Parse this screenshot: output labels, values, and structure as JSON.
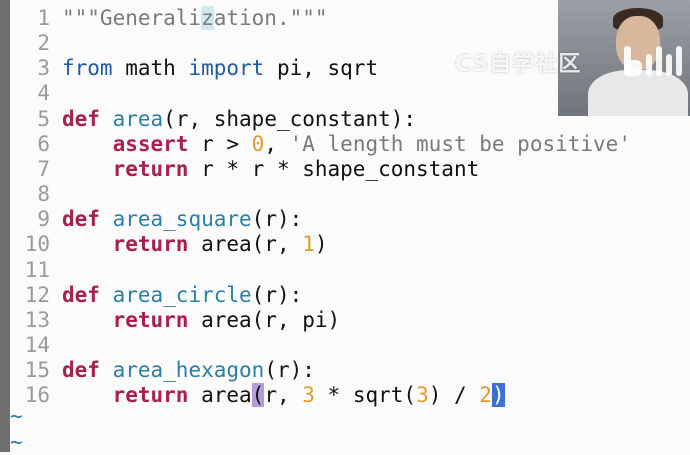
{
  "watermark_text": "CS自学社区",
  "logo_name": "bilibili",
  "colors": {
    "keyword": "#a8204c",
    "builtin_keyword": "#1f5aa8",
    "function_name": "#2a7fa6",
    "number": "#e39a2b",
    "string": "#7a7a7a",
    "cursor": "#3a6fd6",
    "paren_match": "#b39ddb"
  },
  "lines": [
    {
      "n": "1",
      "tokens": [
        {
          "t": "\"\"\"Generali",
          "c": "str"
        },
        {
          "t": "z",
          "c": "str mark"
        },
        {
          "t": "ation.\"\"\"",
          "c": "str"
        }
      ]
    },
    {
      "n": "2",
      "tokens": []
    },
    {
      "n": "3",
      "tokens": [
        {
          "t": "from",
          "c": "kw2"
        },
        {
          "t": " math ",
          "c": "id"
        },
        {
          "t": "import",
          "c": "kw2"
        },
        {
          "t": " pi, sqrt",
          "c": "id"
        }
      ]
    },
    {
      "n": "4",
      "tokens": []
    },
    {
      "n": "5",
      "tokens": [
        {
          "t": "def",
          "c": "kw"
        },
        {
          "t": " ",
          "c": "id"
        },
        {
          "t": "area",
          "c": "fn"
        },
        {
          "t": "(r, shape_constant):",
          "c": "id"
        }
      ]
    },
    {
      "n": "6",
      "tokens": [
        {
          "t": "    ",
          "c": "id"
        },
        {
          "t": "assert",
          "c": "kw"
        },
        {
          "t": " r > ",
          "c": "id"
        },
        {
          "t": "0",
          "c": "num"
        },
        {
          "t": ", ",
          "c": "id"
        },
        {
          "t": "'A length must be positive'",
          "c": "str"
        }
      ]
    },
    {
      "n": "7",
      "tokens": [
        {
          "t": "    ",
          "c": "id"
        },
        {
          "t": "return",
          "c": "kw"
        },
        {
          "t": " r * r * shape_constant",
          "c": "id"
        }
      ]
    },
    {
      "n": "8",
      "tokens": []
    },
    {
      "n": "9",
      "tokens": [
        {
          "t": "def",
          "c": "kw"
        },
        {
          "t": " ",
          "c": "id"
        },
        {
          "t": "area_square",
          "c": "fn"
        },
        {
          "t": "(r):",
          "c": "id"
        }
      ]
    },
    {
      "n": "10",
      "tokens": [
        {
          "t": "    ",
          "c": "id"
        },
        {
          "t": "return",
          "c": "kw"
        },
        {
          "t": " area(r, ",
          "c": "id"
        },
        {
          "t": "1",
          "c": "num"
        },
        {
          "t": ")",
          "c": "id"
        }
      ]
    },
    {
      "n": "11",
      "tokens": []
    },
    {
      "n": "12",
      "tokens": [
        {
          "t": "def",
          "c": "kw"
        },
        {
          "t": " ",
          "c": "id"
        },
        {
          "t": "area_circle",
          "c": "fn"
        },
        {
          "t": "(r):",
          "c": "id"
        }
      ]
    },
    {
      "n": "13",
      "tokens": [
        {
          "t": "    ",
          "c": "id"
        },
        {
          "t": "return",
          "c": "kw"
        },
        {
          "t": " area(r, pi)",
          "c": "id"
        }
      ]
    },
    {
      "n": "14",
      "tokens": []
    },
    {
      "n": "15",
      "tokens": [
        {
          "t": "def",
          "c": "kw"
        },
        {
          "t": " ",
          "c": "id"
        },
        {
          "t": "area_hexagon",
          "c": "fn"
        },
        {
          "t": "(r):",
          "c": "id"
        }
      ]
    },
    {
      "n": "16",
      "tokens": [
        {
          "t": "    ",
          "c": "id"
        },
        {
          "t": "return",
          "c": "kw"
        },
        {
          "t": " area",
          "c": "id"
        },
        {
          "t": "(",
          "c": "match"
        },
        {
          "t": "r, ",
          "c": "id"
        },
        {
          "t": "3",
          "c": "num"
        },
        {
          "t": " * sqrt(",
          "c": "id"
        },
        {
          "t": "3",
          "c": "num"
        },
        {
          "t": ") / ",
          "c": "id"
        },
        {
          "t": "2",
          "c": "num"
        },
        {
          "t": ")",
          "c": "cursor"
        }
      ]
    }
  ],
  "tilde_lines": [
    "~",
    "~"
  ]
}
